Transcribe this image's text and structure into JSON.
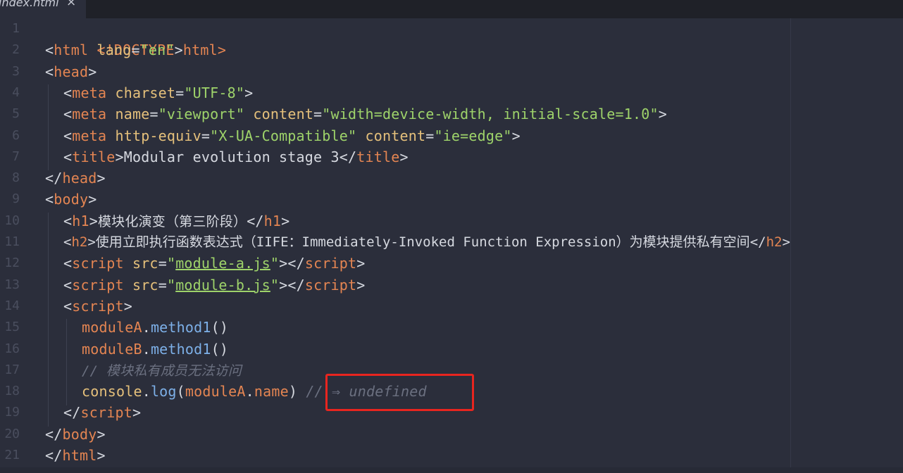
{
  "tab": {
    "filename": "index.html",
    "close": "×"
  },
  "line_numbers": [
    "1",
    "2",
    "3",
    "4",
    "5",
    "6",
    "7",
    "8",
    "9",
    "10",
    "11",
    "12",
    "13",
    "14",
    "15",
    "16",
    "17",
    "18",
    "19",
    "20",
    "21"
  ],
  "code": {
    "l1": [
      "<!DOCTYPE html>"
    ],
    "l2": [
      "<",
      "html",
      " ",
      "lang",
      "=",
      "\"en\"",
      ">"
    ],
    "l3": [
      "<",
      "head",
      ">"
    ],
    "l4": [
      "<",
      "meta",
      " ",
      "charset",
      "=",
      "\"UTF-8\"",
      ">"
    ],
    "l5": [
      "<",
      "meta",
      " ",
      "name",
      "=",
      "\"viewport\"",
      " ",
      "content",
      "=",
      "\"width=device-width, initial-scale=1.0\"",
      ">"
    ],
    "l6": [
      "<",
      "meta",
      " ",
      "http-equiv",
      "=",
      "\"X-UA-Compatible\"",
      " ",
      "content",
      "=",
      "\"ie=edge\"",
      ">"
    ],
    "l7": [
      "<",
      "title",
      ">",
      "Modular evolution stage 3",
      "</",
      "title",
      ">"
    ],
    "l8": [
      "</",
      "head",
      ">"
    ],
    "l9": [
      "<",
      "body",
      ">"
    ],
    "l10": [
      "<",
      "h1",
      ">",
      "模块化演变（第三阶段）",
      "</",
      "h1",
      ">"
    ],
    "l11": [
      "<",
      "h2",
      ">",
      "使用立即执行函数表达式（IIFE：Immediately-Invoked Function Expression）为模块提供私有空间",
      "</",
      "h2",
      ">"
    ],
    "l12": [
      "<",
      "script",
      " ",
      "src",
      "=",
      "\"",
      "module-a.js",
      "\"",
      "></",
      "script",
      ">"
    ],
    "l13": [
      "<",
      "script",
      " ",
      "src",
      "=",
      "\"",
      "module-b.js",
      "\"",
      "></",
      "script",
      ">"
    ],
    "l14": [
      "<",
      "script",
      ">"
    ],
    "l15": [
      "moduleA",
      ".",
      "method1",
      "()"
    ],
    "l16": [
      "moduleB",
      ".",
      "method1",
      "()"
    ],
    "l17": [
      "// 模块私有成员无法访问"
    ],
    "l18": [
      "console",
      ".",
      "log",
      "(",
      "moduleA",
      ".",
      "name",
      ") ",
      "// ⇒ undefined"
    ],
    "l19": [
      "</",
      "script",
      ">"
    ],
    "l20": [
      "</",
      "body",
      ">"
    ],
    "l21": [
      "</",
      "html",
      ">"
    ]
  },
  "colors": {
    "background": "#2b2e3b",
    "tag": "#e48552",
    "attribute": "#e5c07b",
    "string": "#9ed36a",
    "function": "#7db0e8",
    "comment": "#6b7080",
    "highlight_box": "#e8251f"
  }
}
